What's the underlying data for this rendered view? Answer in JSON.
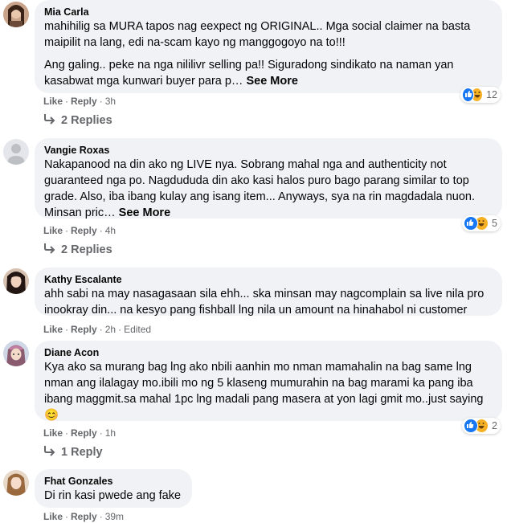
{
  "comments": [
    {
      "author": "Mia Carla",
      "paragraphs": [
        "mahihilig sa MURA tapos nag eexpect ng ORIGINAL.. Mga social claimer na basta maipilit na lang, edi na-scam kayo ng manggogoyo na to!!!",
        "Ang galing.. peke na nga nililivr selling pa!! Siguradong sindikato na naman yan kasabwat mga kunwari buyer para p…"
      ],
      "see_more": "See More",
      "like": "Like",
      "reply": "Reply",
      "time": "3h",
      "reaction_count": "12",
      "replies": "2 Replies"
    },
    {
      "author": "Vangie Roxas",
      "text": "Nakapanood na din ako ng LIVE nya. Sobrang mahal nga and authenticity not guaranteed nga po. Nagdududa din ako kasi halos puro bago parang similar to top grade. Also, iba ibang kulay ang isang item... Anyways, sya na rin magdadala nuon. Minsan pric…",
      "see_more": "See More",
      "like": "Like",
      "reply": "Reply",
      "time": "4h",
      "reaction_count": "5",
      "replies": "2 Replies"
    },
    {
      "author": "Kathy Escalante",
      "text": "ahh sabi na may nasagasaan sila ehh... ska minsan may nagcomplain sa live nila pro inookray din... na kesyo pang fishball lng nila un amount na hinahabol ni customer",
      "like": "Like",
      "reply": "Reply",
      "time": "2h",
      "edited": "Edited"
    },
    {
      "author": "Diane Acon",
      "text": "Kya ako sa murang bag lng ako nbili aanhin mo nman mamahalin na bag same lng nman ang ilalagay mo.ibili mo ng 5 klaseng mumurahin na bag marami ka pang iba ibang maggmit.sa mahal 1pc lng madali pang masera at yon lagi gmit mo..just saying😊",
      "like": "Like",
      "reply": "Reply",
      "time": "1h",
      "reaction_count": "2",
      "replies": "1 Reply"
    },
    {
      "author": "Fhat Gonzales",
      "text": "Di rin kasi pwede ang fake",
      "like": "Like",
      "reply": "Reply",
      "time": "39m"
    }
  ],
  "colors": {
    "bubble": "#f0f2f5",
    "meta": "#65676b",
    "like_reaction": "#1877f2",
    "haha_reaction": "#f7b125"
  },
  "icons": [
    "reply-arrow-icon",
    "like-reaction-icon",
    "haha-reaction-icon"
  ]
}
